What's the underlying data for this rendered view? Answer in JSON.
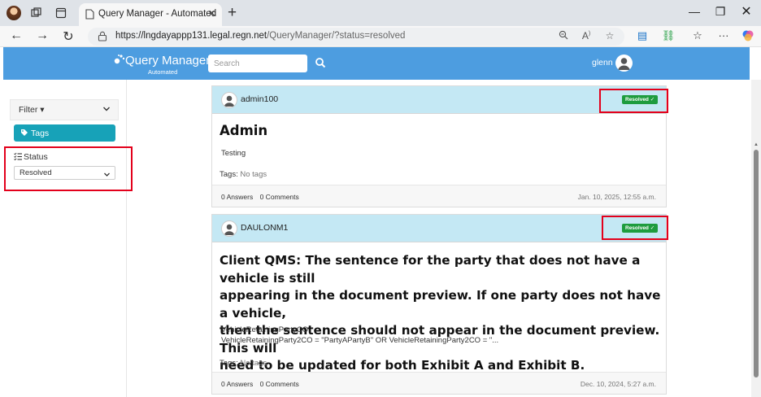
{
  "browser": {
    "tab_title": "Query Manager - Automated",
    "url_host": "https://lngdayappp131.legal.regn.net",
    "url_path": "/QueryManager/?status=resolved"
  },
  "header": {
    "brand_name": "Query Manager",
    "brand_sub": "Automated",
    "search_placeholder": "Search",
    "username": "glenn",
    "bar_color": "#4d9de0"
  },
  "sidebar": {
    "filter_label": "Filter ▾",
    "tags_label": "Tags",
    "status_label": "Status",
    "status_value": "Resolved",
    "tags_color": "#17a2b8"
  },
  "questions": [
    {
      "author": "admin100",
      "status_badge": "Resolved ✓",
      "title": "Admin",
      "body": [
        "Testing"
      ],
      "tags_label": "Tags:",
      "tags_value": "No tags",
      "answers": "0 Answers",
      "comments": "0 Comments",
      "date": "Jan. 10, 2025, 12:55 a.m."
    },
    {
      "author": "DAULONM1",
      "status_badge": "Resolved ✓",
      "title_lines": [
        "Client QMS: The sentence for the party that does not have a vehicle is still",
        "appearing in the document preview. If one party does not have a vehicle,",
        "then the sentence should not appear in the document preview. This will",
        "need to be updated for both Exhibit A and Exhibit B."
      ],
      "body": [
        "VehicleRetainingPartyCO",
        "VehicleRetainingParty2CO = \"PartyAPartyB\" OR VehicleRetainingParty2CO = \"..."
      ],
      "tags_label": "Tags:",
      "tags_value": "No tags",
      "answers": "0 Answers",
      "comments": "0 Comments",
      "date": "Dec. 10, 2024, 5:27 a.m."
    }
  ],
  "colors": {
    "badge": "#1e9c3e",
    "card_header": "#c4e8f4",
    "highlight_box": "#e3001b"
  }
}
